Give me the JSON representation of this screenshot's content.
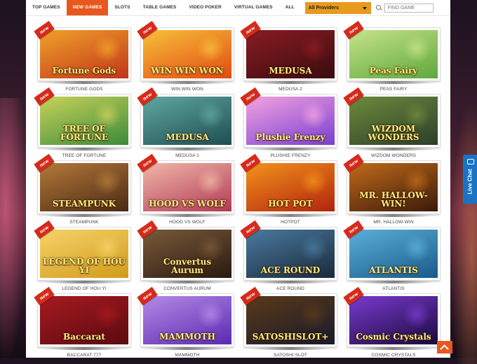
{
  "nav": {
    "items": [
      {
        "label": "TOP GAMES",
        "active": false
      },
      {
        "label": "NEW GAMES",
        "active": true
      },
      {
        "label": "SLOTS",
        "active": false
      },
      {
        "label": "TABLE GAMES",
        "active": false
      },
      {
        "label": "VIDEO POKER",
        "active": false
      },
      {
        "label": "VIRTUAL GAMES",
        "active": false
      },
      {
        "label": "ALL",
        "active": false
      }
    ],
    "provider_select": "All Providers",
    "search_placeholder": "FIND GAME"
  },
  "badge_text": "new",
  "games": [
    {
      "name": "FORTUNE GODS",
      "logo": "Fortune Gods",
      "bg": [
        "#c2351a",
        "#f0a12a"
      ]
    },
    {
      "name": "WIN WIN WON",
      "logo": "WIN WIN WON",
      "bg": [
        "#e24a12",
        "#f7c03a"
      ]
    },
    {
      "name": "MEDUSA 2",
      "logo": "MEDUSA",
      "bg": [
        "#3a0c10",
        "#8a1c22"
      ]
    },
    {
      "name": "PEAS FAIRY",
      "logo": "Peas Fairy",
      "bg": [
        "#5fa83a",
        "#c6e38a"
      ]
    },
    {
      "name": "TREE OF FORTUNE",
      "logo": "TREE OF FORTUNE",
      "bg": [
        "#3b8a3a",
        "#c9d25a"
      ]
    },
    {
      "name": "MEDUSA 1",
      "logo": "MEDUSA",
      "bg": [
        "#1f4d52",
        "#5fa8a0"
      ]
    },
    {
      "name": "PLUSHIE FRENZY",
      "logo": "Plushie Frenzy",
      "bg": [
        "#7a3fd0",
        "#f3a3e0"
      ]
    },
    {
      "name": "WIZDOM WONDERS",
      "logo": "WIZDOM WONDERS",
      "bg": [
        "#2c3f2a",
        "#6e8a3c"
      ]
    },
    {
      "name": "STEAMPUNK",
      "logo": "STEAMPUNK",
      "bg": [
        "#4a2a14",
        "#b4793a"
      ]
    },
    {
      "name": "HOOD VS WOLF",
      "logo": "HOOD VS WOLF",
      "bg": [
        "#b23a54",
        "#f0b7a8"
      ]
    },
    {
      "name": "HOTPOT",
      "logo": "HOT POT",
      "bg": [
        "#b1240c",
        "#f3921c"
      ]
    },
    {
      "name": "MR. HALLOW-WIN",
      "logo": "MR. HALLOW-WIN!",
      "bg": [
        "#3a1a0a",
        "#c26a1a"
      ]
    },
    {
      "name": "LEGEND OF HOU YI",
      "logo": "LEGEND OF HOU YI",
      "bg": [
        "#d39a1a",
        "#f5d36a"
      ]
    },
    {
      "name": "CONVERTUS AURUM",
      "logo": "Convertus Aurum",
      "bg": [
        "#2a1a10",
        "#7a5a3a"
      ]
    },
    {
      "name": "ACE ROUND",
      "logo": "ACE ROUND",
      "bg": [
        "#1a2a3a",
        "#4a7aa0"
      ]
    },
    {
      "name": "ATLANTIS",
      "logo": "ATLANTIS",
      "bg": [
        "#1a5a8a",
        "#5ab0d8"
      ]
    },
    {
      "name": "BACCARAT 777",
      "logo": "Baccarat",
      "bg": [
        "#5a0a10",
        "#a81a20"
      ]
    },
    {
      "name": "MAMMOTH",
      "logo": "MAMMOTH",
      "bg": [
        "#5a2ab0",
        "#b48ae8"
      ]
    },
    {
      "name": "SATOSHI SLOT",
      "logo": "SATOSHISLOT+",
      "bg": [
        "#1a1a2a",
        "#5a3a1a"
      ]
    },
    {
      "name": "COSMIC CRYSTALS",
      "logo": "Cosmic Crystals",
      "bg": [
        "#1a0a3a",
        "#7a3ad0"
      ]
    }
  ],
  "live_chat": {
    "label": "Live Chat"
  }
}
